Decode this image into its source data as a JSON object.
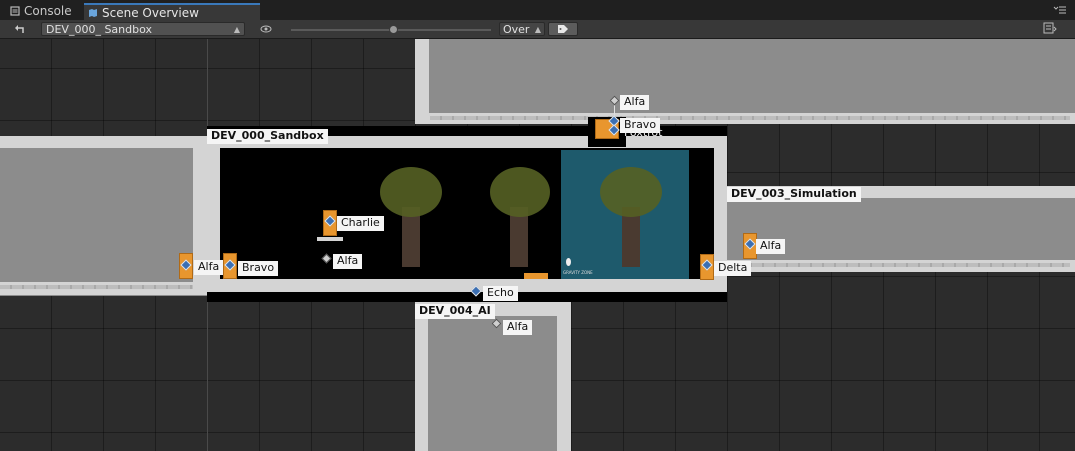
{
  "tabs": {
    "console": "Console",
    "scene_overview": "Scene Overview"
  },
  "toolbar": {
    "scene_selected": "DEV_000_ Sandbox",
    "overlay_mode": "Over"
  },
  "scenes": {
    "sandbox": "DEV_000_Sandbox",
    "simulation": "DEV_003_Simulation",
    "ai": "DEV_004_AI"
  },
  "doors": {
    "top_alfa": "Alfa",
    "top_bravo": "Bravo",
    "top_foxtrot": "Foxtrot",
    "left_alfa": "Alfa",
    "left_bravo": "Bravo",
    "charlie": "Charlie",
    "inner_alfa": "Alfa",
    "echo": "Echo",
    "delta": "Delta",
    "sim_alfa": "Alfa",
    "ai_alfa": "Alfa"
  },
  "gravity_zone": "GRAVITY ZONE",
  "colors": {
    "door_orange": "#e8962e",
    "room_gray": "#8c8c8c",
    "teal_zone": "#1e5a6c",
    "tab_accent": "#3a79bb"
  },
  "icons": [
    "console-icon",
    "map-icon",
    "undo-icon",
    "dropdown-arrow-icon",
    "eye-icon",
    "tag-icon",
    "menu-icon",
    "panel-icon"
  ]
}
